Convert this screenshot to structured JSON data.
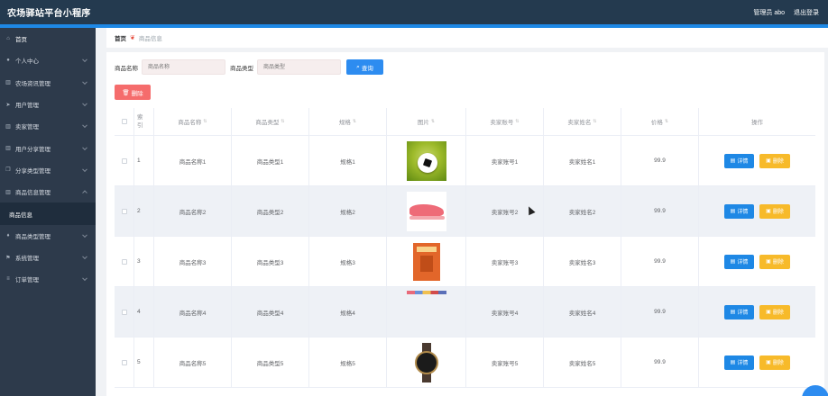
{
  "header": {
    "title": "农场驿站平台小程序",
    "admin_label": "管理员 abo",
    "logout_label": "退出登录"
  },
  "sidebar": {
    "items": [
      {
        "label": "首页",
        "icon": "home-icon"
      },
      {
        "label": "个人中心",
        "icon": "user-icon"
      },
      {
        "label": "农场资讯管理",
        "icon": "bank-icon"
      },
      {
        "label": "用户管理",
        "icon": "send-icon"
      },
      {
        "label": "卖家管理",
        "icon": "bank-icon"
      },
      {
        "label": "用户分享管理",
        "icon": "bank-icon"
      },
      {
        "label": "分享类型管理",
        "icon": "copy-icon"
      },
      {
        "label": "商品信息管理",
        "icon": "bank-icon"
      },
      {
        "label": "商品信息",
        "icon": ""
      },
      {
        "label": "商品类型管理",
        "icon": "mic-icon"
      },
      {
        "label": "系统管理",
        "icon": "flag-icon"
      },
      {
        "label": "订单管理",
        "icon": "equal-icon"
      }
    ]
  },
  "breadcrumb": {
    "home": "首页",
    "current": "商品信息"
  },
  "search": {
    "name_label": "商品名称",
    "name_placeholder": "商品名称",
    "type_label": "商品类型",
    "type_placeholder": "商品类型",
    "query_label": "查询"
  },
  "actions": {
    "delete_label": "删除"
  },
  "table": {
    "headers": {
      "index": "索引",
      "name": "商品名称",
      "type": "商品类型",
      "spec": "规格",
      "image": "图片",
      "seller_account": "卖家账号",
      "seller_name": "卖家姓名",
      "price": "价格",
      "ops": "操作"
    },
    "rows": [
      {
        "index": "1",
        "name": "商品名称1",
        "type": "商品类型1",
        "spec": "规格1",
        "image": "soccer-ball-thumbnail",
        "seller_account": "卖家账号1",
        "seller_name": "卖家姓名1",
        "price": "99.9"
      },
      {
        "index": "2",
        "name": "商品名称2",
        "type": "商品类型2",
        "spec": "规格2",
        "image": "pink-sneaker-thumbnail",
        "seller_account": "卖家账号2",
        "seller_name": "卖家姓名2",
        "price": "99.9"
      },
      {
        "index": "3",
        "name": "商品名称3",
        "type": "商品类型3",
        "spec": "规格3",
        "image": "orange-book-thumbnail",
        "seller_account": "卖家账号3",
        "seller_name": "卖家姓名3",
        "price": "99.9"
      },
      {
        "index": "4",
        "name": "商品名称4",
        "type": "商品类型4",
        "spec": "规格4",
        "image": "color-strip-thumbnail",
        "seller_account": "卖家账号4",
        "seller_name": "卖家姓名4",
        "price": "99.9"
      },
      {
        "index": "5",
        "name": "商品名称5",
        "type": "商品类型5",
        "spec": "规格5",
        "image": "wristwatch-thumbnail",
        "seller_account": "卖家账号5",
        "seller_name": "卖家姓名5",
        "price": "99.9"
      }
    ],
    "detail_label": "详情",
    "row_delete_label": "删除"
  },
  "colors": {
    "topbar": "#243a4f",
    "accent_strip": "#1e88e5",
    "sidebar": "#2d3a4b",
    "primary": "#2d8cf0",
    "danger": "#f56c6c",
    "warning": "#f7ba2a"
  }
}
